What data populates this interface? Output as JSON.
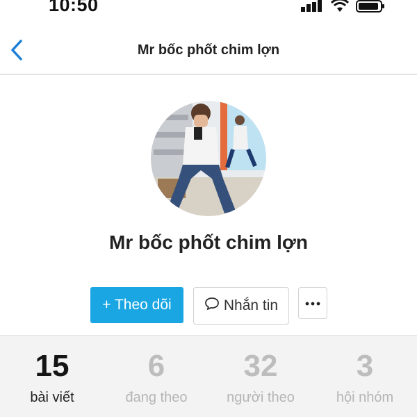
{
  "status_bar": {
    "time": "10:50",
    "icons": [
      "signal-icon",
      "wifi-icon",
      "battery-icon"
    ]
  },
  "nav": {
    "title": "Mr bốc phốt chim lợn",
    "back_icon": "chevron-left-icon"
  },
  "profile": {
    "name": "Mr bốc phốt chim lợn"
  },
  "actions": {
    "follow_label": "+ Theo dõi",
    "message_label": "Nhắn tin",
    "more_label": "···"
  },
  "stats": [
    {
      "value": "15",
      "label": "bài viết",
      "active": true
    },
    {
      "value": "6",
      "label": "đang theo",
      "active": false
    },
    {
      "value": "32",
      "label": "người theo",
      "active": false
    },
    {
      "value": "3",
      "label": "hội nhóm",
      "active": false
    }
  ],
  "colors": {
    "accent": "#1aa6e3",
    "back_icon": "#1a7fd6",
    "stats_bg": "#f3f3f3",
    "stat_inactive": "#bdbdbd"
  }
}
